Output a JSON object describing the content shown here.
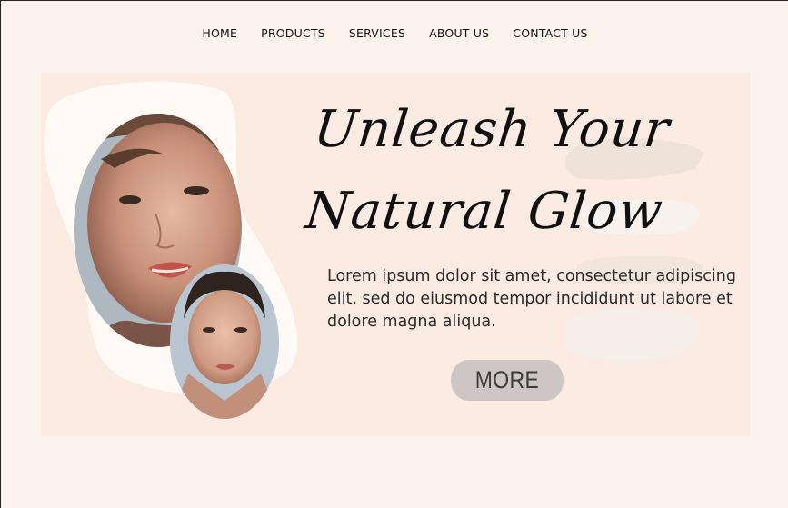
{
  "nav": {
    "items": [
      {
        "label": "HOME"
      },
      {
        "label": "PRODUCTS"
      },
      {
        "label": "SERVICES"
      },
      {
        "label": "ABOUT US"
      },
      {
        "label": "CONTACT US"
      }
    ]
  },
  "hero": {
    "headline_line1": "Unleash Your",
    "headline_line2": "Natural Glow",
    "body": "Lorem ipsum dolor sit amet, consectetur adipiscing elit, sed do eiusmod tempor incididunt ut labore et dolore magna aliqua.",
    "button_label": "MORE"
  },
  "colors": {
    "page_bg": "#fdf3ed",
    "hero_bg": "#fbebe3",
    "blob": "#fffaf6",
    "button_bg": "#cdc6c4",
    "swatch_cream": "#ece0d6",
    "swatch_white": "#f7f2ee"
  }
}
